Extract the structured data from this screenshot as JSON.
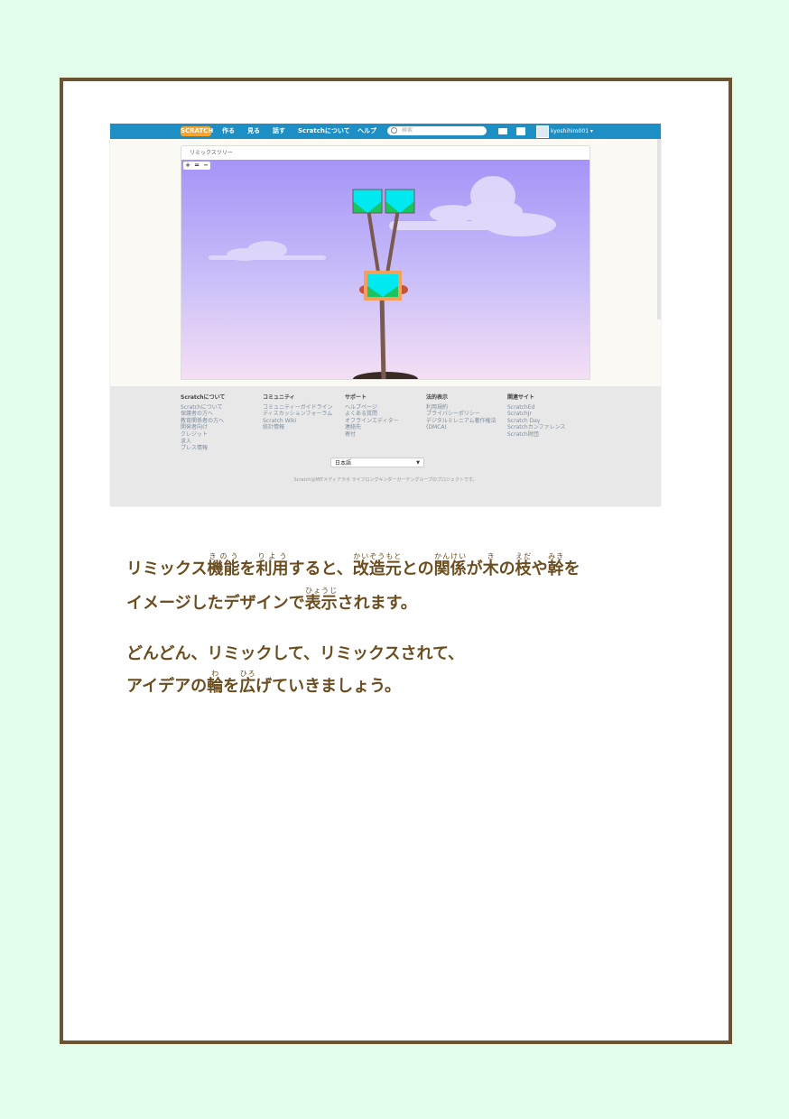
{
  "topbar": {
    "logo": "SCRATCH",
    "nav": [
      "作る",
      "見る",
      "話す",
      "Scratchについて",
      "ヘルプ"
    ],
    "search_placeholder": "検索",
    "username": "kyoshihiro001 ▾"
  },
  "panel": {
    "title": "リミックスツリー",
    "zoom_in": "+",
    "zoom_reset": "=",
    "zoom_out": "−"
  },
  "footer": {
    "columns": [
      {
        "heading": "Scratchについて",
        "links": [
          "Scratchについて",
          "保護者の方へ",
          "教育関係者の方へ",
          "開発者向け",
          "クレジット",
          "求人",
          "プレス情報"
        ]
      },
      {
        "heading": "コミュニティ",
        "links": [
          "コミュニティーガイドライン",
          "ディスカッションフォーラム",
          "Scratch Wiki",
          "統計情報"
        ]
      },
      {
        "heading": "サポート",
        "links": [
          "ヘルプページ",
          "よくある質問",
          "オフラインエディター",
          "連絡先",
          "寄付"
        ]
      },
      {
        "heading": "法的表示",
        "links": [
          "利用規約",
          "プライバシーポリシー",
          "デジタルミレニアム著作権法",
          "(DMCA)"
        ]
      },
      {
        "heading": "関連サイト",
        "links": [
          "ScratchEd",
          "ScratchJr",
          "Scratch Day",
          "Scratchカンファレンス",
          "Scratch財団"
        ]
      }
    ],
    "language": "日本語",
    "credit": "ScratchはMITメディアラボ ライフロングキンダーガーテングループのプロジェクトです。"
  },
  "body_text": {
    "line1": [
      [
        "リミックス",
        ""
      ],
      [
        "機能",
        "きのう"
      ],
      [
        "を",
        ""
      ],
      [
        "利用",
        "りよう"
      ],
      [
        "すると、",
        ""
      ],
      [
        "改造元",
        "かいぞうもと"
      ],
      [
        "との",
        ""
      ],
      [
        "関係",
        "かんけい"
      ],
      [
        "が",
        ""
      ],
      [
        "木",
        "き"
      ],
      [
        "の",
        ""
      ],
      [
        "枝",
        "えだ"
      ],
      [
        "や",
        ""
      ],
      [
        "幹",
        "みき"
      ],
      [
        "を",
        ""
      ]
    ],
    "line2": [
      [
        "イメージしたデザインで",
        ""
      ],
      [
        "表示",
        "ひょうじ"
      ],
      [
        "されます。",
        ""
      ]
    ],
    "line3": [
      [
        "どんどん、リミックして、リミックスされて、",
        ""
      ]
    ],
    "line4": [
      [
        "アイデアの",
        ""
      ],
      [
        "輪",
        "わ"
      ],
      [
        "を",
        ""
      ],
      [
        "広",
        "ひろ"
      ],
      [
        "げていきましょう。",
        ""
      ]
    ]
  },
  "colors": {
    "topbar": "#1d8fc4",
    "frame": "#6b5430",
    "text": "#6b4d1f",
    "background": "#e3fdec"
  }
}
